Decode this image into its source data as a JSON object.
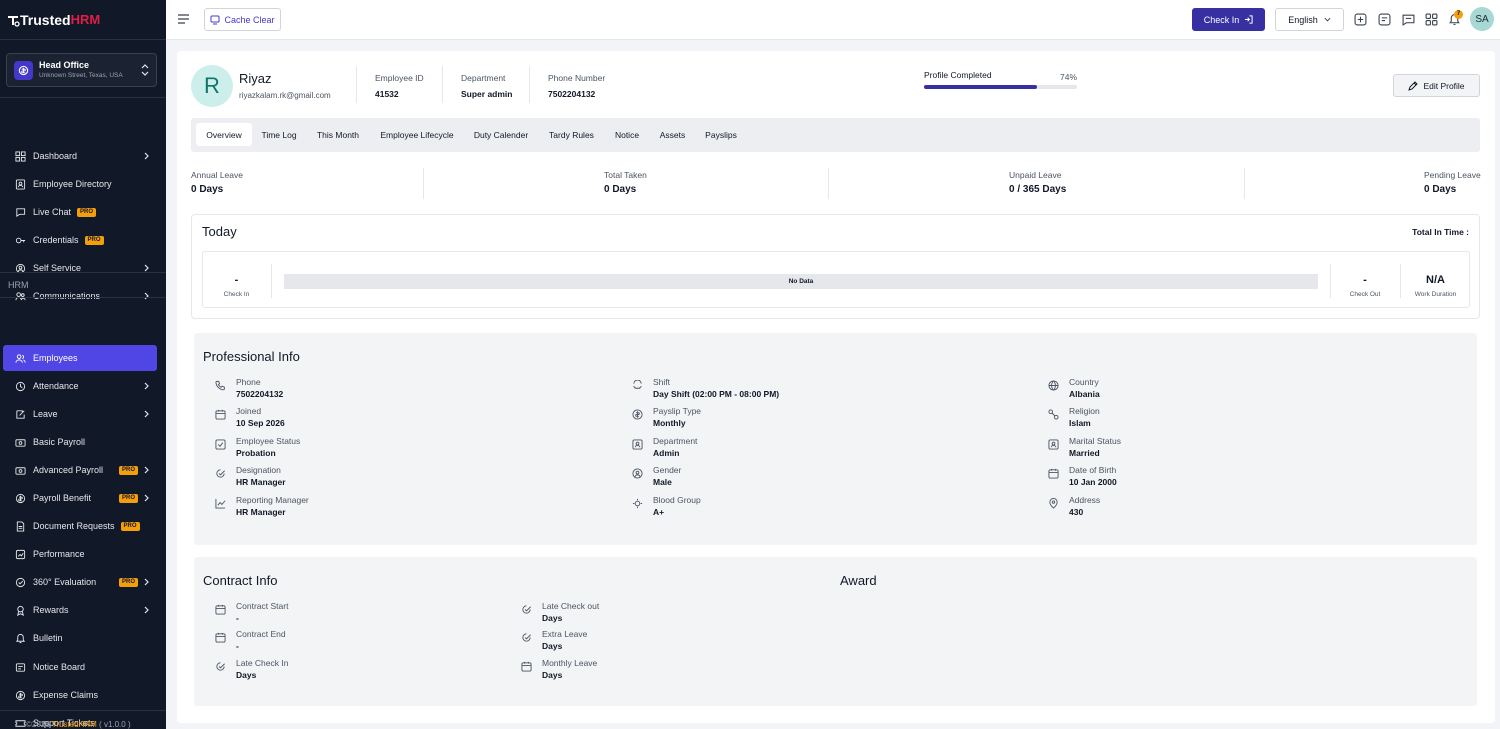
{
  "brand": {
    "trusted": "Trusted",
    "hrm": "HRM"
  },
  "branch": {
    "name": "Head Office",
    "address": "Unknown Street, Texas, USA"
  },
  "sidebar": {
    "items": [
      {
        "label": "Dashboard"
      },
      {
        "label": "Employee Directory"
      },
      {
        "label": "Live Chat",
        "badge": "PRO"
      },
      {
        "label": "Credentials",
        "badge": "PRO"
      },
      {
        "label": "Self Service"
      },
      {
        "label": "Communications"
      }
    ],
    "section_label": "HRM",
    "hrm_items": [
      {
        "label": "Employees"
      },
      {
        "label": "Attendance"
      },
      {
        "label": "Leave"
      },
      {
        "label": "Basic Payroll"
      },
      {
        "label": "Advanced Payroll",
        "badge": "PRO"
      },
      {
        "label": "Payroll Benefit",
        "badge": "PRO"
      },
      {
        "label": "Document Requests",
        "badge": "PRO"
      },
      {
        "label": "Performance"
      },
      {
        "label": "360° Evaluation",
        "badge": "PRO"
      },
      {
        "label": "Rewards"
      },
      {
        "label": "Bulletin"
      },
      {
        "label": "Notice Board"
      },
      {
        "label": "Expense Claims"
      },
      {
        "label": "Support Tickets"
      }
    ],
    "footer": {
      "copy": "©2026 ",
      "brand": "TrustedHRM",
      "version": " ( v1.0.0 )"
    }
  },
  "topbar": {
    "cache_clear": "Cache Clear",
    "check_in": "Check In",
    "language": "English",
    "notification_count": "7",
    "avatar_initials": "SA"
  },
  "profile": {
    "initial": "R",
    "name": "Riyaz",
    "email": "riyazkalam.rk@gmail.com",
    "employee_id_label": "Employee ID",
    "employee_id": "41532",
    "department_label": "Department",
    "department": "Super admin",
    "phone_label": "Phone Number",
    "phone": "7502204132",
    "completed_label": "Profile Completed",
    "completed_percent": "74%",
    "completed_fraction": 0.74,
    "edit_label": "Edit Profile"
  },
  "tabs": [
    "Overview",
    "Time Log",
    "This Month",
    "Employee Lifecycle",
    "Duty Calender",
    "Tardy Rules",
    "Notice",
    "Assets",
    "Payslips"
  ],
  "leave_stats": [
    {
      "label": "Annual Leave",
      "value": "0 Days"
    },
    {
      "label": "Total Taken",
      "value": "0 Days"
    },
    {
      "label": "Unpaid Leave",
      "value": "0 / 365 Days"
    },
    {
      "label": "Pending Leave",
      "value": "0 Days"
    }
  ],
  "today": {
    "title": "Today",
    "total_in_time": "Total In Time :",
    "check_in_value": "-",
    "check_in_label": "Check In",
    "no_data": "No Data",
    "check_out_value": "-",
    "check_out_label": "Check Out",
    "work_duration_value": "N/A",
    "work_duration_label": "Work Duration"
  },
  "professional_info": {
    "title": "Professional Info",
    "fields": [
      {
        "label": "Phone",
        "value": "7502204132",
        "icon": "phone-icon"
      },
      {
        "label": "Joined",
        "value": "10 Sep 2026",
        "icon": "calendar-icon"
      },
      {
        "label": "Employee Status",
        "value": "Probation",
        "icon": "status-icon"
      },
      {
        "label": "Designation",
        "value": "HR Manager",
        "icon": "designation-icon"
      },
      {
        "label": "Reporting Manager",
        "value": "HR Manager",
        "icon": "chart-icon"
      },
      {
        "label": "Shift",
        "value": "Day Shift (02:00 PM - 08:00 PM)",
        "icon": "shift-icon"
      },
      {
        "label": "Payslip Type",
        "value": "Monthly",
        "icon": "money-icon"
      },
      {
        "label": "Department",
        "value": "Admin",
        "icon": "department-icon"
      },
      {
        "label": "Gender",
        "value": "Male",
        "icon": "gender-icon"
      },
      {
        "label": "Blood Group",
        "value": "A+",
        "icon": "blood-icon"
      },
      {
        "label": "Country",
        "value": "Albania",
        "icon": "globe-icon"
      },
      {
        "label": "Religion",
        "value": "Islam",
        "icon": "religion-icon"
      },
      {
        "label": "Marital Status",
        "value": "Married",
        "icon": "marital-icon"
      },
      {
        "label": "Date of Birth",
        "value": "10 Jan 2000",
        "icon": "calendar-icon"
      },
      {
        "label": "Address",
        "value": "430",
        "icon": "location-icon"
      }
    ]
  },
  "contract_info": {
    "title": "Contract Info",
    "award_title": "Award",
    "fields": [
      {
        "label": "Contract Start",
        "value": "-",
        "icon": "calendar-icon"
      },
      {
        "label": "Contract End",
        "value": "-",
        "icon": "calendar-icon"
      },
      {
        "label": "Late Check In",
        "value": "Days",
        "icon": "clock-check-icon"
      },
      {
        "label": "Late Check out",
        "value": "Days",
        "icon": "clock-check-icon"
      },
      {
        "label": "Extra Leave",
        "value": "Days",
        "icon": "clock-check-icon"
      },
      {
        "label": "Monthly Leave",
        "value": "Days",
        "icon": "calendar-icon"
      }
    ]
  },
  "colors": {
    "primary": "#3730a3",
    "sidebar_bg": "#111827",
    "active_nav": "#4f46e5",
    "pro_badge": "#f59e0b"
  }
}
